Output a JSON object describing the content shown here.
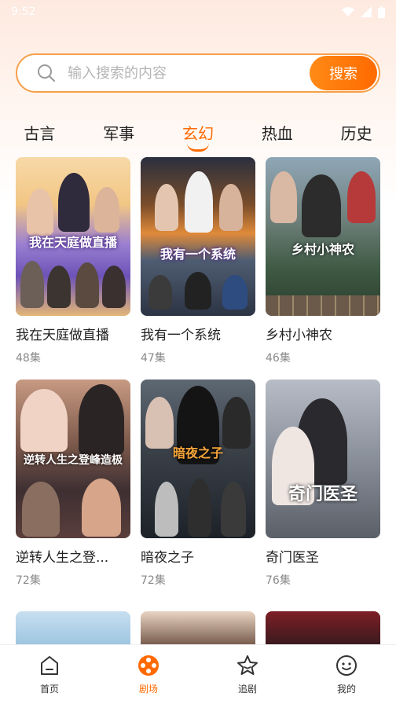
{
  "status": {
    "time": "9:52"
  },
  "search": {
    "placeholder": "输入搜索的内容",
    "button_label": "搜索"
  },
  "tabs": [
    {
      "label": "古言",
      "active": false
    },
    {
      "label": "军事",
      "active": false
    },
    {
      "label": "玄幻",
      "active": true
    },
    {
      "label": "热血",
      "active": false
    },
    {
      "label": "历史",
      "active": false
    }
  ],
  "shows": [
    {
      "title": "我在天庭做直播",
      "episodes": "48集",
      "poster_text": "我在天庭做直播"
    },
    {
      "title": "我有一个系统",
      "episodes": "47集",
      "poster_text": "我有一个系统"
    },
    {
      "title": "乡村小神农",
      "episodes": "46集",
      "poster_text": "乡村小神农"
    },
    {
      "title": "逆转人生之登...",
      "episodes": "72集",
      "poster_text": "逆转人生之登峰造极"
    },
    {
      "title": "暗夜之子",
      "episodes": "72集",
      "poster_text": "暗夜之子"
    },
    {
      "title": "奇门医圣",
      "episodes": "76集",
      "poster_text": "奇门医圣"
    }
  ],
  "bottom_nav": [
    {
      "label": "首页",
      "icon": "home-icon",
      "active": false
    },
    {
      "label": "剧场",
      "icon": "film-reel-icon",
      "active": true
    },
    {
      "label": "追剧",
      "icon": "star-icon",
      "active": false
    },
    {
      "label": "我的",
      "icon": "smiley-icon",
      "active": false
    }
  ],
  "colors": {
    "accent": "#ff6a00",
    "search_border": "#f6a04a"
  }
}
